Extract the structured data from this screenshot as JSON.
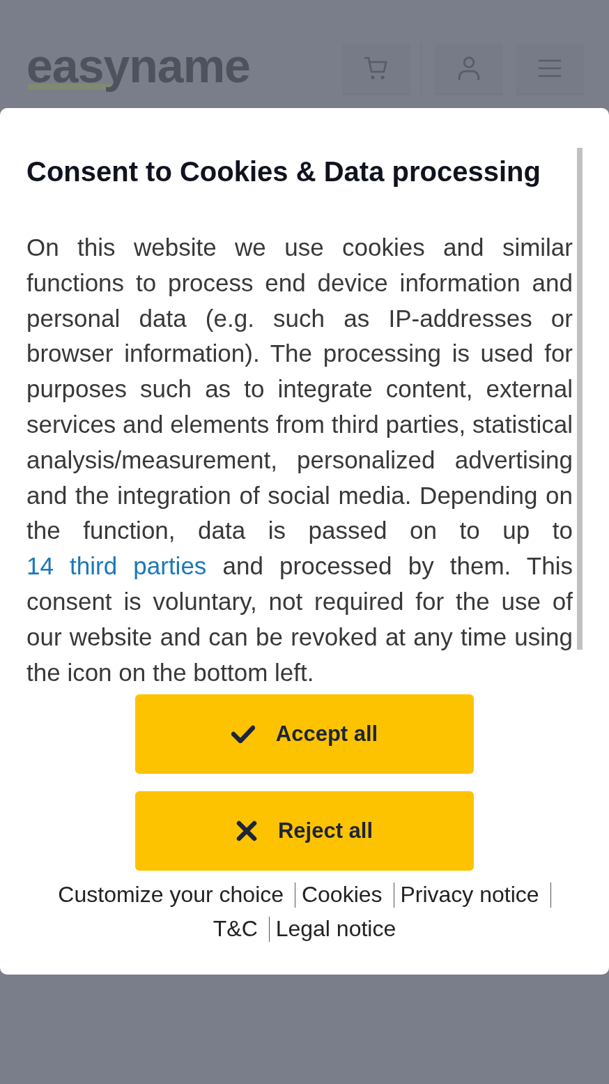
{
  "background_page": {
    "logo": "easyname"
  },
  "dialog": {
    "title": "Consent to Cookies & Data processing",
    "body": [
      {
        "kind": "text",
        "text": "On this website we use cookies and similar functions to process end device information and personal data (e.g. such as IP-addresses or browser information). The processing is used for purposes such as to integrate content, external services and elements from third parties, statistical analysis/measurement, personalized advertising and the integration of social media. Depending on the function, data is passed on to up to "
      },
      {
        "kind": "link",
        "text": "14 third parties"
      },
      {
        "kind": "text",
        "text": " and processed by them. This consent is voluntary, not required for the use of our website and can be revoked at any time using the icon on the bottom left."
      }
    ],
    "buttons": [
      {
        "kind": "accept",
        "label": "Accept all"
      },
      {
        "kind": "reject",
        "label": "Reject all"
      }
    ],
    "links": [
      "Customize your choice",
      "Cookies",
      "Privacy notice",
      "T&C",
      "Legal notice"
    ]
  }
}
